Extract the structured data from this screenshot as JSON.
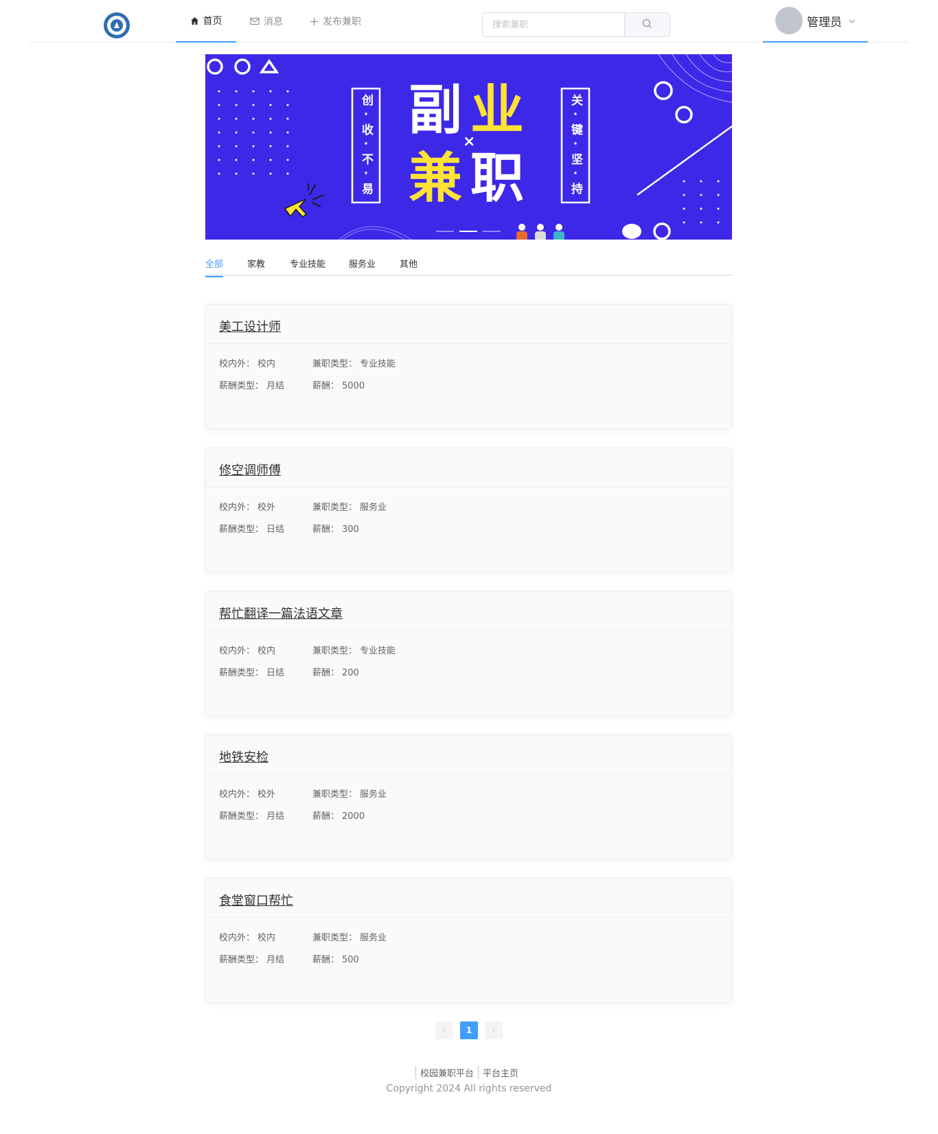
{
  "header": {
    "nav": {
      "home": "首页",
      "messages": "消息",
      "post_job": "发布兼职"
    },
    "search": {
      "placeholder": "搜索兼职"
    },
    "user": {
      "name": "管理员"
    }
  },
  "banner": {
    "left_vertical": "创·收·不·易",
    "right_vertical": "关·键·坚·持",
    "title_top_a": "副",
    "title_top_b": "业",
    "title_x": "×",
    "title_bottom_a": "兼",
    "title_bottom_b": "职"
  },
  "tabs": [
    "全部",
    "家教",
    "专业技能",
    "服务业",
    "其他"
  ],
  "labels": {
    "location": "校内外：",
    "job_type": "兼职类型：",
    "pay_type": "薪酬类型：",
    "salary": "薪酬："
  },
  "jobs": [
    {
      "title": "美工设计师",
      "location": "校内",
      "job_type": "专业技能",
      "pay_type": "月结",
      "salary": "5000"
    },
    {
      "title": "修空调师傅",
      "location": "校外",
      "job_type": "服务业",
      "pay_type": "日结",
      "salary": "300"
    },
    {
      "title": "帮忙翻译一篇法语文章",
      "location": "校内",
      "job_type": "专业技能",
      "pay_type": "日结",
      "salary": "200"
    },
    {
      "title": "地铁安检",
      "location": "校外",
      "job_type": "服务业",
      "pay_type": "月结",
      "salary": "2000"
    },
    {
      "title": "食堂窗口帮忙",
      "location": "校内",
      "job_type": "服务业",
      "pay_type": "月结",
      "salary": "500"
    }
  ],
  "pagination": {
    "prev": "‹",
    "current": "1",
    "next": "›"
  },
  "footer": {
    "links": [
      "校园兼职平台",
      "平台主页"
    ],
    "copyright": "Copyright 2024 All rights reserved"
  }
}
